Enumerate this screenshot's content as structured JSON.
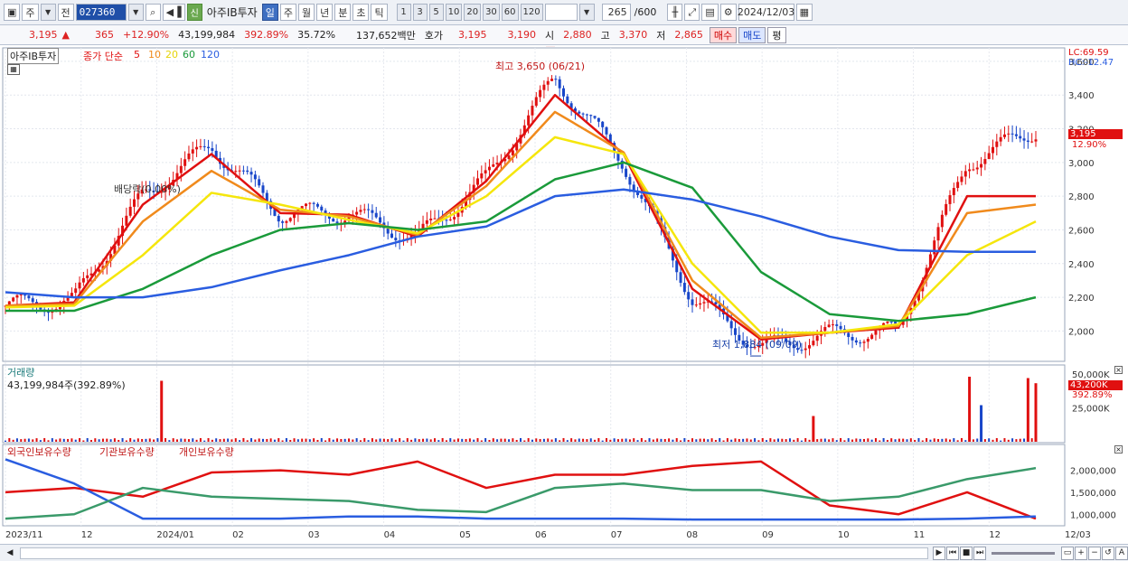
{
  "toolbar": {
    "market_label": "주",
    "prev_label": "전",
    "code": "027360",
    "new_badge": "신",
    "stock_name": "아주IB투자",
    "periods": [
      "일",
      "주",
      "월",
      "년",
      "분",
      "초",
      "틱"
    ],
    "intervals": [
      "1",
      "3",
      "5",
      "10",
      "20",
      "30",
      "60",
      "120"
    ],
    "count": "265",
    "count_total": "/600",
    "date": "2024/12/03"
  },
  "quote": {
    "price": "3,195",
    "change_arrow": "▲",
    "change": "365",
    "change_pct": "+12.90%",
    "volume": "43,199,984",
    "volume_ratio": "392.89%",
    "turnover_pct": "35.72%",
    "amount": "137,652백만",
    "bid_label": "호가",
    "ask_price": "3,195",
    "bid_price": "3,190",
    "open_label": "시",
    "open": "2,880",
    "high_label": "고",
    "high": "3,370",
    "low_label": "저",
    "low": "2,865",
    "buy_label": "매수",
    "sell_label": "매도",
    "eval_label": "평"
  },
  "legend": {
    "name_box": "아주IB투자",
    "ma_label": "종가 단순",
    "ma_periods": [
      "5",
      "10",
      "20",
      "60",
      "120"
    ],
    "lc": "LC:69.59",
    "hc": "HC:-12.47",
    "last_price": "3,195",
    "last_pct": "12.90%",
    "high_note": "최고 3,650 (06/21)",
    "low_note": "최저 1,884 (09/09)",
    "dividend_note": "배당락(0.00%)"
  },
  "volume_panel": {
    "title": "거래량",
    "value": "43,199,984주(392.89%)",
    "last": "43,200K",
    "last_pct": "392.89%"
  },
  "holding_panel": {
    "foreign": "외국인보유수량",
    "inst": "기관보유수량",
    "retail": "개인보유수량"
  },
  "colors": {
    "ma5": "#e01010",
    "ma10": "#f08a1c",
    "ma20": "#f5e60c",
    "ma60": "#1a9a3a",
    "ma120": "#2a5de0",
    "up": "#e01010",
    "down": "#1846c9",
    "foreign": "#e01010",
    "inst": "#2a5de0",
    "retail": "#3a9a6a"
  },
  "chart_data": [
    {
      "type": "candlestick-line",
      "title": "아주IB투자",
      "x_labels": [
        "2023/11",
        "12",
        "2024/01",
        "02",
        "03",
        "04",
        "05",
        "06",
        "07",
        "08",
        "09",
        "10",
        "11",
        "12",
        "12/03"
      ],
      "y_ticks": [
        2000,
        2200,
        2400,
        2600,
        2800,
        3000,
        3200,
        3400,
        3600
      ],
      "ylim": [
        1820,
        3680
      ],
      "close_path_dates": [
        "2023-11",
        "2023-12-20",
        "2024-01-05",
        "2024-01-20",
        "2024-02",
        "2024-03",
        "2024-04",
        "2024-05",
        "2024-06-21",
        "2024-07",
        "2024-08",
        "2024-09-09",
        "2024-10",
        "2024-11-15",
        "2024-11-20",
        "2024-12-03"
      ],
      "close_values": [
        2150,
        2180,
        2800,
        3100,
        2700,
        2700,
        2550,
        2900,
        3500,
        3000,
        2200,
        1900,
        1980,
        2000,
        3000,
        3195
      ],
      "series": [
        {
          "name": "5",
          "values": [
            2150,
            2170,
            2750,
            3050,
            2700,
            2690,
            2560,
            2890,
            3400,
            3050,
            2250,
            1950,
            1990,
            2020,
            2800,
            2800
          ]
        },
        {
          "name": "10",
          "values": [
            2150,
            2160,
            2650,
            2950,
            2720,
            2680,
            2570,
            2860,
            3300,
            3060,
            2300,
            1960,
            1990,
            2030,
            2700,
            2750
          ]
        },
        {
          "name": "20",
          "values": [
            2140,
            2150,
            2450,
            2820,
            2750,
            2660,
            2580,
            2800,
            3150,
            3050,
            2400,
            1990,
            1990,
            2040,
            2450,
            2650
          ]
        },
        {
          "name": "60",
          "values": [
            2120,
            2120,
            2250,
            2450,
            2600,
            2640,
            2600,
            2650,
            2900,
            3000,
            2850,
            2350,
            2100,
            2060,
            2100,
            2200
          ]
        },
        {
          "name": "120",
          "values": [
            2230,
            2200,
            2200,
            2260,
            2360,
            2450,
            2560,
            2620,
            2800,
            2840,
            2780,
            2680,
            2560,
            2480,
            2470,
            2470
          ]
        }
      ],
      "high": {
        "value": 3650,
        "date": "06/21"
      },
      "low": {
        "value": 1884,
        "date": "09/09"
      }
    },
    {
      "type": "bar",
      "title": "거래량",
      "y_ticks": [
        "50,000K",
        "25,000K"
      ],
      "ylim": [
        0,
        50000
      ],
      "last": 43200,
      "spikes_dates": [
        "2023-12-20",
        "2024-06-05",
        "2024-11-13",
        "2024-11-15",
        "2024-12-02",
        "2024-12-03"
      ],
      "spikes_values": [
        45000,
        19000,
        48000,
        27000,
        47000,
        43200
      ]
    },
    {
      "type": "line",
      "title": "보유수량",
      "y_ticks": [
        "2,000,000",
        "1,500,000",
        "1,000,000"
      ],
      "ylim": [
        800000,
        2300000
      ],
      "series": [
        {
          "name": "외국인보유수량",
          "values": [
            1500000,
            1600000,
            1400000,
            1950000,
            2000000,
            1900000,
            2200000,
            1600000,
            1900000,
            1900000,
            2100000,
            2200000,
            1200000,
            1000000,
            1500000,
            900000
          ]
        },
        {
          "name": "기관보유수량",
          "values": [
            2250000,
            1700000,
            900000,
            900000,
            900000,
            950000,
            950000,
            900000,
            900000,
            900000,
            880000,
            880000,
            880000,
            880000,
            900000,
            950000
          ]
        },
        {
          "name": "개인보유수량",
          "values": [
            900000,
            1000000,
            1600000,
            1400000,
            1350000,
            1300000,
            1100000,
            1050000,
            1600000,
            1700000,
            1550000,
            1550000,
            1300000,
            1400000,
            1800000,
            2050000
          ]
        }
      ]
    }
  ]
}
